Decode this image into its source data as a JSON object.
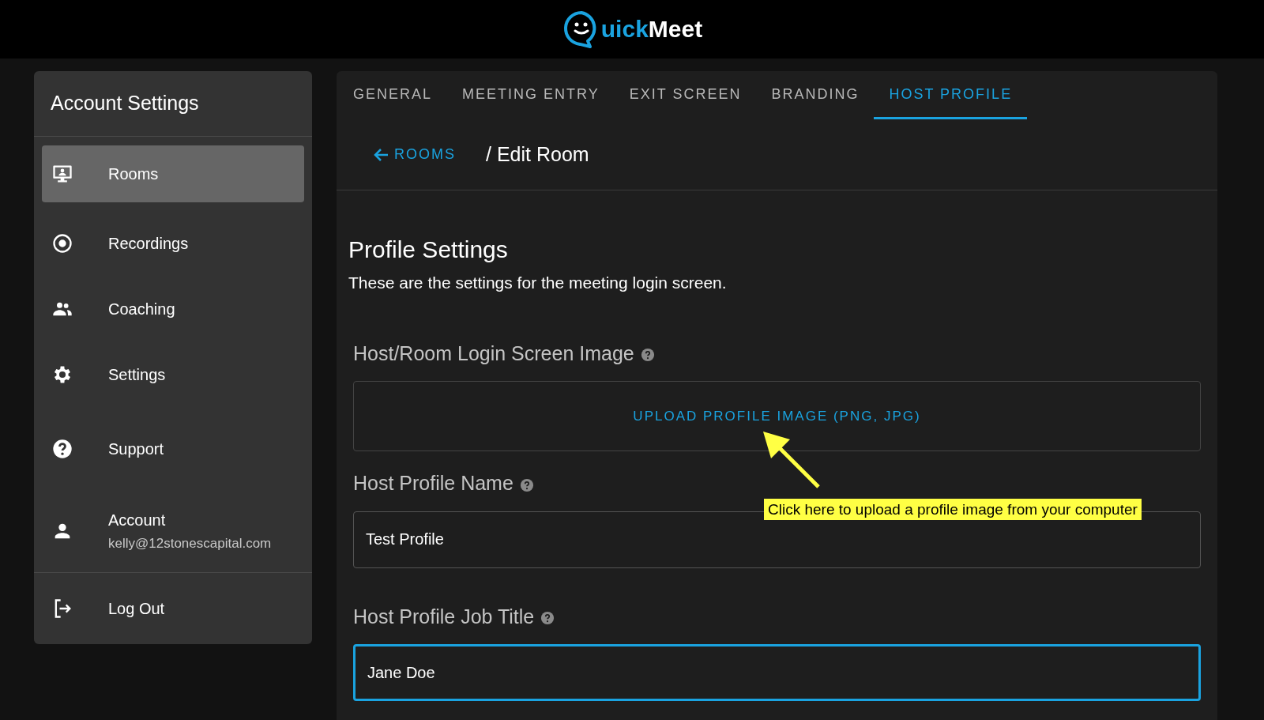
{
  "logo": {
    "accent": "uick",
    "text": "Meet"
  },
  "sidebar": {
    "title": "Account Settings",
    "items": [
      {
        "label": "Rooms",
        "selected": true
      },
      {
        "label": "Recordings",
        "selected": false
      },
      {
        "label": "Coaching",
        "selected": false
      },
      {
        "label": "Settings",
        "selected": false
      },
      {
        "label": "Support",
        "selected": false
      },
      {
        "label": "Account",
        "subtitle": "kelly@12stonescapital.com",
        "selected": false
      }
    ],
    "logout": "Log Out"
  },
  "tabs": [
    {
      "label": "GENERAL",
      "selected": false
    },
    {
      "label": "MEETING ENTRY",
      "selected": false
    },
    {
      "label": "EXIT SCREEN",
      "selected": false
    },
    {
      "label": "BRANDING",
      "selected": false
    },
    {
      "label": "HOST PROFILE",
      "selected": true
    }
  ],
  "breadcrumb": {
    "back": "ROOMS",
    "current": "/ Edit Room"
  },
  "section": {
    "title": "Profile Settings",
    "description": "These are the settings for the meeting login screen."
  },
  "fields": [
    {
      "kind": "upload",
      "label": "Host/Room Login Screen Image",
      "button": "UPLOAD PROFILE IMAGE (PNG, JPG)"
    },
    {
      "kind": "text",
      "label": "Host Profile Name",
      "value": "Test Profile",
      "focused": false
    },
    {
      "kind": "text",
      "label": "Host Profile Job Title",
      "value": "Jane Doe",
      "focused": true
    }
  ],
  "annotation": {
    "text": "Click here to upload a profile image from your computer"
  }
}
